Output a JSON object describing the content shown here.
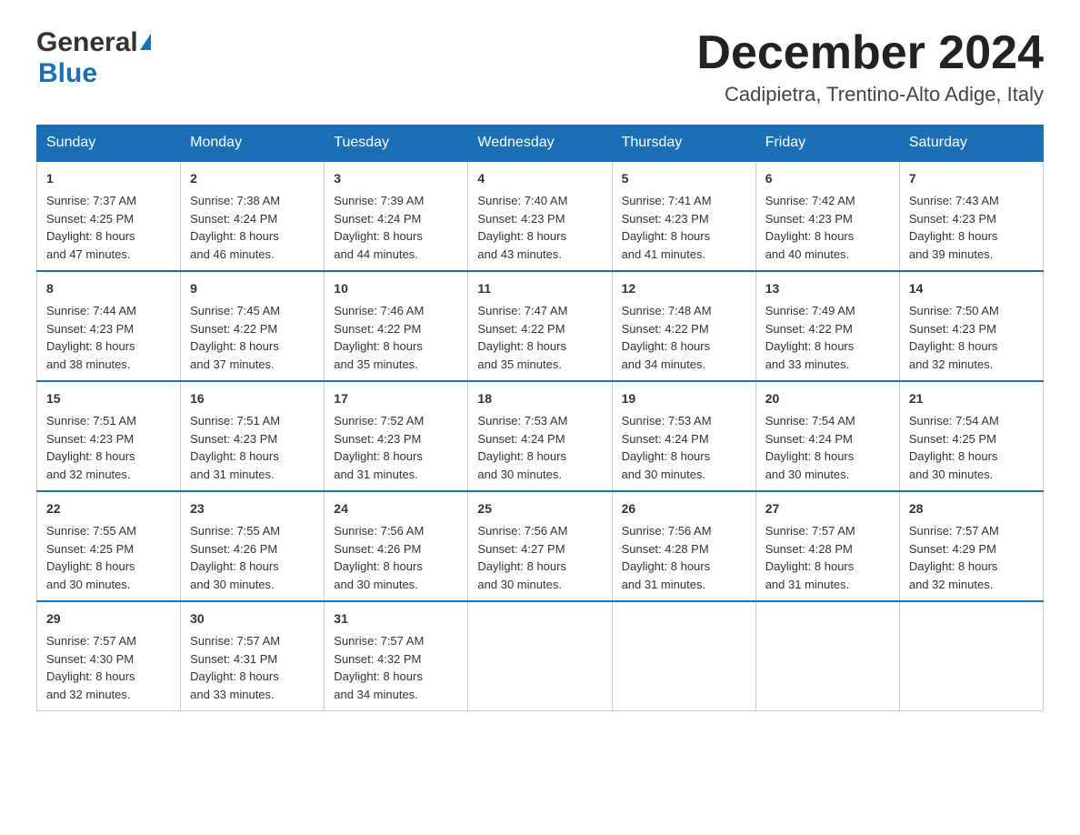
{
  "header": {
    "logo_general": "General",
    "logo_blue": "Blue",
    "month_title": "December 2024",
    "subtitle": "Cadipietra, Trentino-Alto Adige, Italy"
  },
  "days_of_week": [
    "Sunday",
    "Monday",
    "Tuesday",
    "Wednesday",
    "Thursday",
    "Friday",
    "Saturday"
  ],
  "weeks": [
    [
      {
        "day": "1",
        "sunrise": "7:37 AM",
        "sunset": "4:25 PM",
        "daylight": "8 hours and 47 minutes."
      },
      {
        "day": "2",
        "sunrise": "7:38 AM",
        "sunset": "4:24 PM",
        "daylight": "8 hours and 46 minutes."
      },
      {
        "day": "3",
        "sunrise": "7:39 AM",
        "sunset": "4:24 PM",
        "daylight": "8 hours and 44 minutes."
      },
      {
        "day": "4",
        "sunrise": "7:40 AM",
        "sunset": "4:23 PM",
        "daylight": "8 hours and 43 minutes."
      },
      {
        "day": "5",
        "sunrise": "7:41 AM",
        "sunset": "4:23 PM",
        "daylight": "8 hours and 41 minutes."
      },
      {
        "day": "6",
        "sunrise": "7:42 AM",
        "sunset": "4:23 PM",
        "daylight": "8 hours and 40 minutes."
      },
      {
        "day": "7",
        "sunrise": "7:43 AM",
        "sunset": "4:23 PM",
        "daylight": "8 hours and 39 minutes."
      }
    ],
    [
      {
        "day": "8",
        "sunrise": "7:44 AM",
        "sunset": "4:23 PM",
        "daylight": "8 hours and 38 minutes."
      },
      {
        "day": "9",
        "sunrise": "7:45 AM",
        "sunset": "4:22 PM",
        "daylight": "8 hours and 37 minutes."
      },
      {
        "day": "10",
        "sunrise": "7:46 AM",
        "sunset": "4:22 PM",
        "daylight": "8 hours and 35 minutes."
      },
      {
        "day": "11",
        "sunrise": "7:47 AM",
        "sunset": "4:22 PM",
        "daylight": "8 hours and 35 minutes."
      },
      {
        "day": "12",
        "sunrise": "7:48 AM",
        "sunset": "4:22 PM",
        "daylight": "8 hours and 34 minutes."
      },
      {
        "day": "13",
        "sunrise": "7:49 AM",
        "sunset": "4:22 PM",
        "daylight": "8 hours and 33 minutes."
      },
      {
        "day": "14",
        "sunrise": "7:50 AM",
        "sunset": "4:23 PM",
        "daylight": "8 hours and 32 minutes."
      }
    ],
    [
      {
        "day": "15",
        "sunrise": "7:51 AM",
        "sunset": "4:23 PM",
        "daylight": "8 hours and 32 minutes."
      },
      {
        "day": "16",
        "sunrise": "7:51 AM",
        "sunset": "4:23 PM",
        "daylight": "8 hours and 31 minutes."
      },
      {
        "day": "17",
        "sunrise": "7:52 AM",
        "sunset": "4:23 PM",
        "daylight": "8 hours and 31 minutes."
      },
      {
        "day": "18",
        "sunrise": "7:53 AM",
        "sunset": "4:24 PM",
        "daylight": "8 hours and 30 minutes."
      },
      {
        "day": "19",
        "sunrise": "7:53 AM",
        "sunset": "4:24 PM",
        "daylight": "8 hours and 30 minutes."
      },
      {
        "day": "20",
        "sunrise": "7:54 AM",
        "sunset": "4:24 PM",
        "daylight": "8 hours and 30 minutes."
      },
      {
        "day": "21",
        "sunrise": "7:54 AM",
        "sunset": "4:25 PM",
        "daylight": "8 hours and 30 minutes."
      }
    ],
    [
      {
        "day": "22",
        "sunrise": "7:55 AM",
        "sunset": "4:25 PM",
        "daylight": "8 hours and 30 minutes."
      },
      {
        "day": "23",
        "sunrise": "7:55 AM",
        "sunset": "4:26 PM",
        "daylight": "8 hours and 30 minutes."
      },
      {
        "day": "24",
        "sunrise": "7:56 AM",
        "sunset": "4:26 PM",
        "daylight": "8 hours and 30 minutes."
      },
      {
        "day": "25",
        "sunrise": "7:56 AM",
        "sunset": "4:27 PM",
        "daylight": "8 hours and 30 minutes."
      },
      {
        "day": "26",
        "sunrise": "7:56 AM",
        "sunset": "4:28 PM",
        "daylight": "8 hours and 31 minutes."
      },
      {
        "day": "27",
        "sunrise": "7:57 AM",
        "sunset": "4:28 PM",
        "daylight": "8 hours and 31 minutes."
      },
      {
        "day": "28",
        "sunrise": "7:57 AM",
        "sunset": "4:29 PM",
        "daylight": "8 hours and 32 minutes."
      }
    ],
    [
      {
        "day": "29",
        "sunrise": "7:57 AM",
        "sunset": "4:30 PM",
        "daylight": "8 hours and 32 minutes."
      },
      {
        "day": "30",
        "sunrise": "7:57 AM",
        "sunset": "4:31 PM",
        "daylight": "8 hours and 33 minutes."
      },
      {
        "day": "31",
        "sunrise": "7:57 AM",
        "sunset": "4:32 PM",
        "daylight": "8 hours and 34 minutes."
      },
      null,
      null,
      null,
      null
    ]
  ],
  "labels": {
    "sunrise": "Sunrise:",
    "sunset": "Sunset:",
    "daylight": "Daylight:"
  }
}
